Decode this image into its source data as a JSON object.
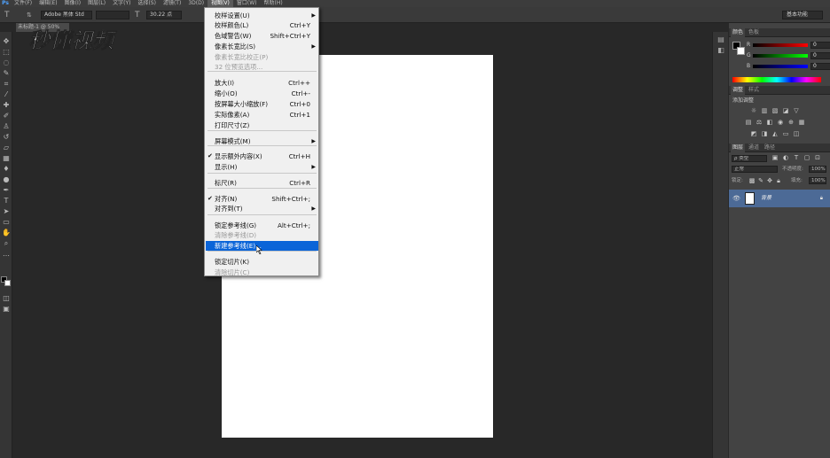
{
  "menubar": {
    "logo": "Ps",
    "items": [
      {
        "label": "文件(F)"
      },
      {
        "label": "编辑(E)"
      },
      {
        "label": "图像(I)"
      },
      {
        "label": "图层(L)"
      },
      {
        "label": "文字(Y)"
      },
      {
        "label": "选择(S)"
      },
      {
        "label": "滤镜(T)"
      },
      {
        "label": "3D(D)"
      },
      {
        "label": "视图(V)"
      },
      {
        "label": "窗口(W)"
      },
      {
        "label": "帮助(H)"
      }
    ]
  },
  "options": {
    "font_family": "Adobe 黑体 Std",
    "font_size": "30.22 点",
    "workspace": "基本功能"
  },
  "document_tab": "未标题-1 @ 50%",
  "watermark": "秒懂视频",
  "view_menu": {
    "items": [
      {
        "label": "校样设置(U)",
        "shortcut": "",
        "submenu": true
      },
      {
        "label": "校样颜色(L)",
        "shortcut": "Ctrl+Y"
      },
      {
        "label": "色域警告(W)",
        "shortcut": "Shift+Ctrl+Y"
      },
      {
        "label": "像素长宽比(S)",
        "shortcut": "",
        "submenu": true
      },
      {
        "label": "像素长宽比校正(P)",
        "shortcut": "",
        "disabled": true
      },
      {
        "label": "32 位预览选项...",
        "shortcut": "",
        "disabled": true
      },
      {
        "label": "放大(I)",
        "shortcut": "Ctrl++"
      },
      {
        "label": "缩小(O)",
        "shortcut": "Ctrl+-"
      },
      {
        "label": "按屏幕大小缩放(F)",
        "shortcut": "Ctrl+0"
      },
      {
        "label": "实际像素(A)",
        "shortcut": "Ctrl+1"
      },
      {
        "label": "打印尺寸(Z)",
        "shortcut": ""
      },
      {
        "label": "屏幕模式(M)",
        "shortcut": "",
        "submenu": true
      },
      {
        "label": "显示额外内容(X)",
        "shortcut": "Ctrl+H",
        "checked": true
      },
      {
        "label": "显示(H)",
        "shortcut": "",
        "submenu": true
      },
      {
        "label": "标尺(R)",
        "shortcut": "Ctrl+R"
      },
      {
        "label": "对齐(N)",
        "shortcut": "Shift+Ctrl+;",
        "checked": true
      },
      {
        "label": "对齐到(T)",
        "shortcut": "",
        "submenu": true
      },
      {
        "label": "锁定参考线(G)",
        "shortcut": "Alt+Ctrl+;"
      },
      {
        "label": "清除参考线(D)",
        "shortcut": "",
        "disabled": true
      },
      {
        "label": "新建参考线(E)...",
        "shortcut": "",
        "highlighted": true
      },
      {
        "label": "锁定切片(K)",
        "shortcut": ""
      },
      {
        "label": "清除切片(C)",
        "shortcut": "",
        "disabled": true
      }
    ]
  },
  "color_panel": {
    "tabs": [
      "颜色",
      "色板"
    ],
    "channels": [
      {
        "name": "R",
        "value": "0"
      },
      {
        "name": "G",
        "value": "0"
      },
      {
        "name": "B",
        "value": "0"
      }
    ]
  },
  "adjust_panel": {
    "tabs": [
      "调整",
      "样式"
    ],
    "title": "添加调整"
  },
  "layers_panel": {
    "tabs": [
      "图层",
      "通道",
      "路径"
    ],
    "kind": "ρ 类型",
    "blend_mode": "正常",
    "opacity_label": "不透明度:",
    "opacity": "100%",
    "lock_label": "锁定:",
    "fill_label": "填充:",
    "fill": "100%",
    "layer_name": "背景"
  },
  "colors": {
    "menu_highlight": "#0a64d8",
    "layer_selected": "#4c6a96"
  }
}
